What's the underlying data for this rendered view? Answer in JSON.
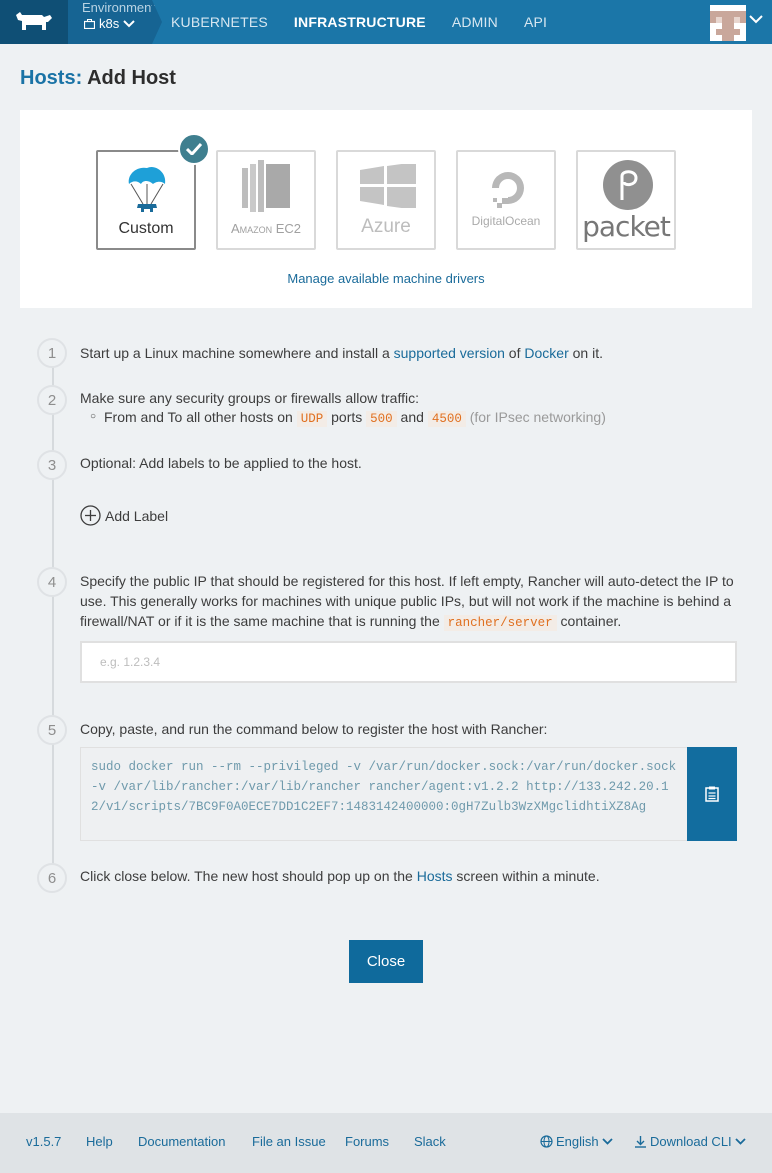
{
  "header": {
    "env_label": "Environment",
    "env_value": "k8s",
    "nav": [
      "KUBERNETES",
      "INFRASTRUCTURE",
      "ADMIN",
      "API"
    ],
    "active_nav": "INFRASTRUCTURE"
  },
  "page": {
    "crumb": "Hosts:",
    "title": "Add Host"
  },
  "drivers": {
    "items": [
      "Custom",
      "Amazon EC2",
      "Azure",
      "DigitalOcean",
      "packet"
    ],
    "selected": "Custom",
    "manage_link": "Manage available machine drivers"
  },
  "steps": {
    "s1": {
      "num": "1",
      "a": "Start up a Linux machine somewhere and install a ",
      "link1": "supported version",
      "b": " of ",
      "link2": "Docker",
      "c": " on it."
    },
    "s2": {
      "num": "2",
      "text": "Make sure any security groups or firewalls allow traffic:",
      "bullet_a": "From and To all other hosts on ",
      "proto": "UDP",
      "bullet_b": " ports ",
      "port1": "500",
      "bullet_c": " and ",
      "port2": "4500",
      "note": " (for IPsec networking)"
    },
    "s3": {
      "num": "3",
      "text": "Optional: Add labels to be applied to the host.",
      "add_label": "Add Label"
    },
    "s4": {
      "num": "4",
      "text": "Specify the public IP that should be registered for this host. If left empty, Rancher will auto-detect the IP to use. This generally works for machines with unique public IPs, but will not work if the machine is behind a firewall/NAT or if it is the same machine that is running the ",
      "code": "rancher/server",
      "text_end": " container.",
      "placeholder": "e.g. 1.2.3.4"
    },
    "s5": {
      "num": "5",
      "text": "Copy, paste, and run the command below to register the host with Rancher:",
      "command": "sudo docker run --rm --privileged -v /var/run/docker.sock:/var/run/docker.sock -v /var/lib/rancher:/var/lib/rancher rancher/agent:v1.2.2 http://133.242.20.12/v1/scripts/7BC9F0A0ECE7DD1C2EF7:1483142400000:0gH7Zulb3WzXMgclidhtiXZ8Ag"
    },
    "s6": {
      "num": "6",
      "a": "Click close below. The new host should pop up on the ",
      "link": "Hosts",
      "b": " screen within a minute."
    }
  },
  "close_label": "Close",
  "footer": {
    "version": "v1.5.7",
    "help": "Help",
    "docs": "Documentation",
    "issue": "File an Issue",
    "forums": "Forums",
    "slack": "Slack",
    "language": "English",
    "cli": "Download CLI"
  },
  "colors": {
    "nav_bg": "#1b76a8",
    "brand_bg": "#0f4f75",
    "link": "#1a6b9a",
    "primary_button": "#0f6a9c",
    "check_badge": "#3f7f8f"
  },
  "icons": [
    "rancher-cow-icon",
    "briefcase-icon",
    "chevron-down-icon",
    "check-icon",
    "plus-circle-icon",
    "clipboard-icon",
    "globe-icon",
    "download-icon"
  ]
}
